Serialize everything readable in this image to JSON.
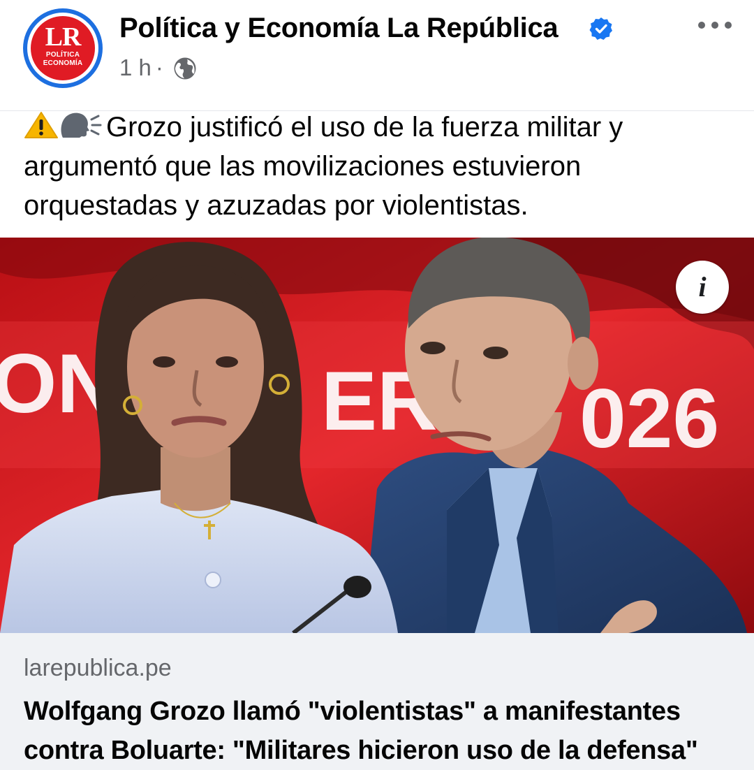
{
  "post": {
    "page_name": "Política y Economía La República",
    "time": "1 h",
    "separator": "·",
    "body_text": "Grozo justificó el uso de la fuerza militar y argumentó que las movilizaciones estuvieron orquestadas y azuzadas por violentistas."
  },
  "avatar": {
    "logo_letters": "LR",
    "logo_line1": "POLÍTICA",
    "logo_line2": "ECONOMÍA"
  },
  "image_backdrop": {
    "text_left": "ONE",
    "text_middle": "ERA",
    "text_right": "026"
  },
  "info_button": {
    "glyph": "i"
  },
  "link_preview": {
    "domain": "larepublica.pe",
    "title": "Wolfgang Grozo llamó \"violentistas\" a manifestantes contra Boluarte: \"Militares hicieron uso de la defensa\""
  },
  "icons": {
    "verified": "verified-badge-icon",
    "audience": "globe-icon",
    "more": "more-options-icon",
    "warning": "warning-emoji-icon",
    "speaking": "speaking-head-emoji-icon"
  },
  "colors": {
    "brand_blue": "#1d6fe0",
    "brand_red": "#e01b24",
    "verified_blue": "#1877f2",
    "secondary_text": "#65676b",
    "link_box_bg": "#f0f2f5"
  }
}
